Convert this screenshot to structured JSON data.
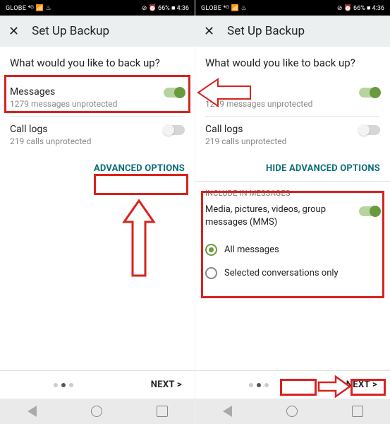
{
  "status": {
    "left": "GLOBE ⁴ᴳ 📶 ♨",
    "right": "⊘ ⏰ 66% ■ 4:36"
  },
  "appbar": {
    "close": "✕",
    "title": "Set Up Backup"
  },
  "question": "What would you like to back up?",
  "items": {
    "messages": {
      "title": "Messages",
      "sub": "1279 messages unprotected"
    },
    "calllogs": {
      "title": "Call logs",
      "sub": "219 calls unprotected"
    }
  },
  "left_panel": {
    "link": "ADVANCED OPTIONS"
  },
  "right_panel": {
    "link": "HIDE ADVANCED OPTIONS",
    "section": "INCLUDE IN MESSAGES",
    "media": "Media, pictures, videos, group messages (MMS)",
    "opt_all": "All messages",
    "opt_sel": "Selected conversations only"
  },
  "bottom": {
    "next": "NEXT >"
  }
}
